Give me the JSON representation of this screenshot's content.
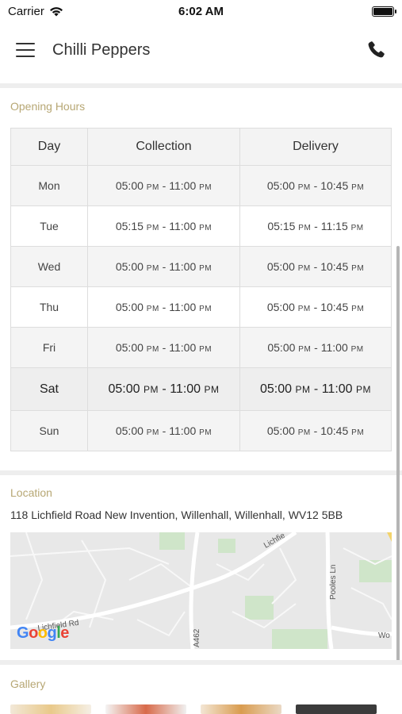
{
  "status_bar": {
    "carrier": "Carrier",
    "time": "6:02 AM"
  },
  "nav": {
    "title": "Chilli Peppers"
  },
  "opening_hours": {
    "label": "Opening Hours",
    "headers": [
      "Day",
      "Collection",
      "Delivery"
    ],
    "rows": [
      {
        "day": "Mon",
        "collection": [
          "05:00",
          "PM",
          "11:00",
          "PM"
        ],
        "delivery": [
          "05:00",
          "PM",
          "10:45",
          "PM"
        ]
      },
      {
        "day": "Tue",
        "collection": [
          "05:15",
          "PM",
          "11:00",
          "PM"
        ],
        "delivery": [
          "05:15",
          "PM",
          "11:15",
          "PM"
        ]
      },
      {
        "day": "Wed",
        "collection": [
          "05:00",
          "PM",
          "11:00",
          "PM"
        ],
        "delivery": [
          "05:00",
          "PM",
          "10:45",
          "PM"
        ]
      },
      {
        "day": "Thu",
        "collection": [
          "05:00",
          "PM",
          "11:00",
          "PM"
        ],
        "delivery": [
          "05:00",
          "PM",
          "10:45",
          "PM"
        ]
      },
      {
        "day": "Fri",
        "collection": [
          "05:00",
          "PM",
          "11:00",
          "PM"
        ],
        "delivery": [
          "05:00",
          "PM",
          "11:00",
          "PM"
        ]
      },
      {
        "day": "Sat",
        "collection": [
          "05:00",
          "PM",
          "11:00",
          "PM"
        ],
        "delivery": [
          "05:00",
          "PM",
          "11:00",
          "PM"
        ]
      },
      {
        "day": "Sun",
        "collection": [
          "05:00",
          "PM",
          "11:00",
          "PM"
        ],
        "delivery": [
          "05:00",
          "PM",
          "10:45",
          "PM"
        ]
      }
    ]
  },
  "location": {
    "label": "Location",
    "address": "118 Lichfield Road New Invention, Willenhall, Willenhall, WV12 5BB",
    "map_labels": {
      "road1": "Lichfield Rd",
      "road2": "Lichfie",
      "road3": "Pooles Ln",
      "road4": "A462",
      "road5": "Wo"
    },
    "google_logo": "Google"
  },
  "gallery": {
    "label": "Gallery"
  },
  "colors": {
    "accent": "#b7a774",
    "map_bg": "#e8e8e8",
    "map_green": "#cfe5c9",
    "map_road": "#ffffff"
  }
}
